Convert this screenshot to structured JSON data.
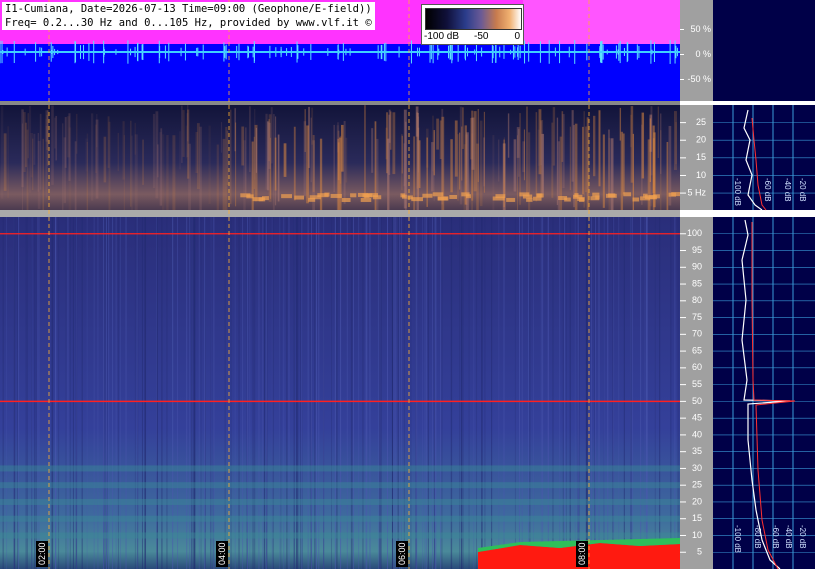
{
  "header": {
    "line1": "I1-Cumiana, Date=2026-07-13 Time=09:00 (Geophone/E-field))",
    "line2": "Freq= 0.2...30 Hz and 0...105 Hz, provided by www.vlf.it ©"
  },
  "colorbar": {
    "labels": [
      "-100 dB",
      "-50",
      "0"
    ]
  },
  "colors": {
    "waveform_bg": "#0000ff",
    "amplitude_magenta": "#ff33ff",
    "waveform_cyan": "#3fd0ff",
    "right_panel_bg": "#000048",
    "axis_strip": "#a0a0a0",
    "marker_line": "#ff2020",
    "time_grid": "#ffb030"
  },
  "chart_data": [
    {
      "type": "line",
      "panel": "waveform",
      "ylabel_ticks": [
        "50 %",
        "0 %",
        "-50 %"
      ],
      "ylim": [
        -100,
        100
      ]
    },
    {
      "type": "heatmap",
      "panel": "spectrogram-low",
      "y_ticks": [
        "25",
        "20",
        "15",
        "10",
        "5 Hz"
      ],
      "ylim": [
        0.2,
        30
      ],
      "time_labels": [
        "02:00",
        "04:00",
        "06:00",
        "08:00"
      ]
    },
    {
      "type": "heatmap",
      "panel": "spectrogram-high",
      "y_ticks": [
        "100",
        "95",
        "90",
        "85",
        "80",
        "75",
        "70",
        "65",
        "60",
        "55",
        "50",
        "45",
        "40",
        "35",
        "30",
        "25",
        "20",
        "15",
        "10",
        "5"
      ],
      "ylim": [
        0,
        105
      ],
      "time_labels": [
        "02:00",
        "04:00",
        "06:00",
        "08:00"
      ],
      "marker_lines_hz": [
        100,
        50
      ]
    },
    {
      "type": "line",
      "panel": "spectrum-low",
      "x_ticks": [
        "-100 dB",
        "-60 dB",
        "-40 dB",
        "-20 dB"
      ]
    },
    {
      "type": "line",
      "panel": "spectrum-high",
      "x_ticks": [
        "-100 dB",
        "-80 dB",
        "-60 dB",
        "-40 dB",
        "-20 dB"
      ]
    }
  ]
}
